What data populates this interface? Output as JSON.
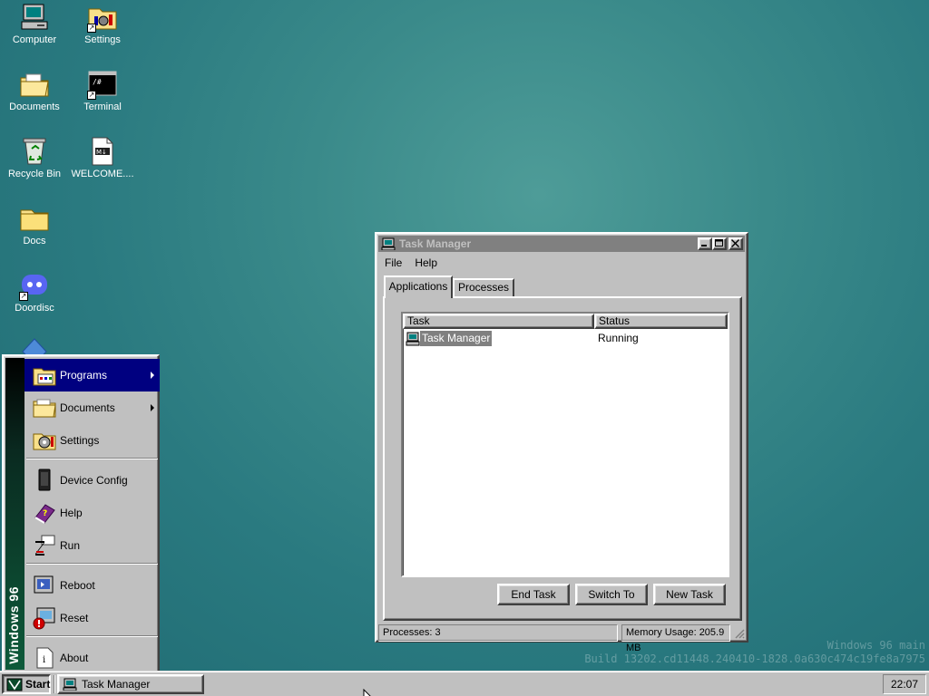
{
  "desktop": {
    "icons": [
      {
        "label": "Computer"
      },
      {
        "label": "Settings"
      },
      {
        "label": "Documents"
      },
      {
        "label": "Terminal"
      },
      {
        "label": "Recycle Bin"
      },
      {
        "label": "WELCOME...."
      },
      {
        "label": "Docs"
      },
      {
        "label": "Doordisc"
      }
    ],
    "watermark_line1": "Windows 96 main",
    "watermark_line2": "Build 13202.cd11448.240410-1828.0a630c474c19fe8a7975"
  },
  "start_menu": {
    "banner": "Windows 96",
    "items": [
      {
        "label": "Programs",
        "icon": "programs-icon",
        "has_submenu": true
      },
      {
        "label": "Documents",
        "icon": "folder-icon",
        "has_submenu": true
      },
      {
        "label": "Settings",
        "icon": "settings-icon",
        "has_submenu": false
      },
      {
        "label": "Device Config",
        "icon": "device-icon",
        "has_submenu": false
      },
      {
        "label": "Help",
        "icon": "help-book-icon",
        "has_submenu": false
      },
      {
        "label": "Run",
        "icon": "run-icon",
        "has_submenu": false
      },
      {
        "label": "Reboot",
        "icon": "reboot-icon",
        "has_submenu": false
      },
      {
        "label": "Reset",
        "icon": "reset-icon",
        "has_submenu": false
      },
      {
        "label": "About",
        "icon": "about-icon",
        "has_submenu": false
      }
    ]
  },
  "taskbar": {
    "start_label": "Start",
    "task_label": "Task Manager",
    "clock": "22:07"
  },
  "task_manager": {
    "title": "Task Manager",
    "menu": [
      "File",
      "Help"
    ],
    "tabs": [
      "Applications",
      "Processes"
    ],
    "columns": [
      "Task",
      "Status"
    ],
    "rows": [
      {
        "task": "Task Manager",
        "status": "Running"
      }
    ],
    "buttons": {
      "end_task": "End Task",
      "switch_to": "Switch To",
      "new_task": "New Task"
    },
    "status": {
      "processes": "Processes: 3",
      "memory": "Memory Usage: 205.9 MB"
    }
  }
}
